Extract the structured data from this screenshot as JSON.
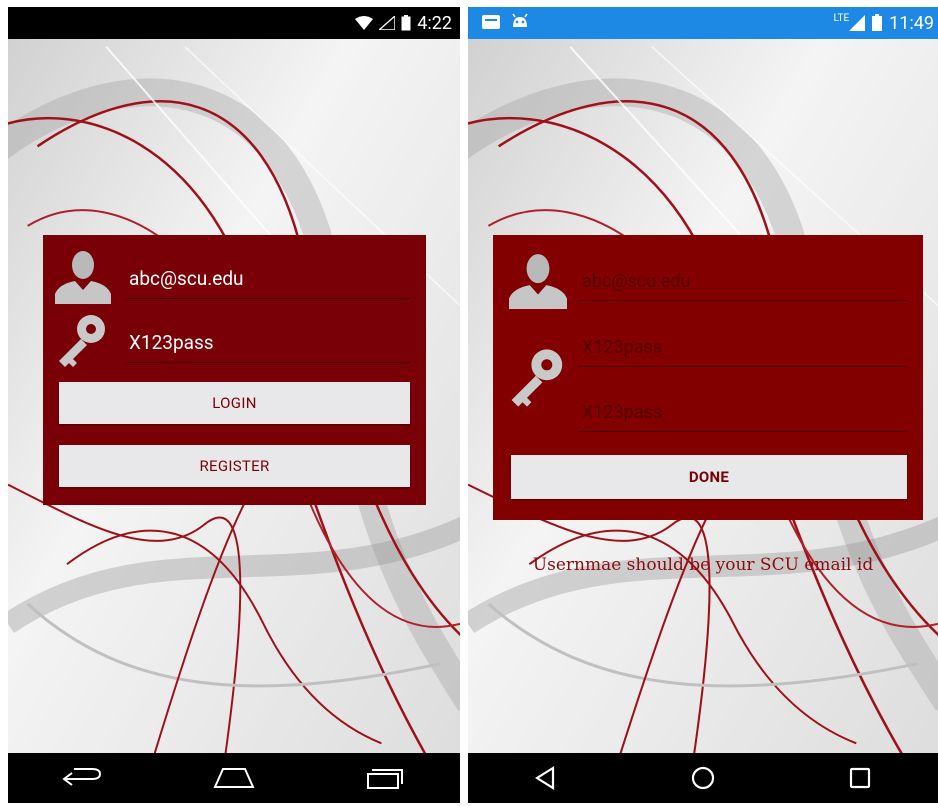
{
  "left": {
    "status": {
      "time": "4:22",
      "icons": [
        "wifi-icon",
        "signal-icon",
        "battery-icon"
      ]
    },
    "login": {
      "username_value": "abc@scu.edu",
      "password_value": "X123pass",
      "login_label": "LOGIN",
      "register_label": "REGISTER"
    },
    "nav": [
      "back-icon",
      "home-icon",
      "recents-icon"
    ]
  },
  "right": {
    "status": {
      "time": "11:49",
      "network": "LTE",
      "icons": [
        "message-icon",
        "android-icon",
        "signal-icon",
        "battery-icon"
      ]
    },
    "register": {
      "username_placeholder": "abc@scu.edu",
      "password_placeholder": "X123pass",
      "confirm_placeholder": "X123pass",
      "done_label": "DONE",
      "hint": "Usernmae should be your SCU email id"
    },
    "nav": [
      "back-triangle-icon",
      "home-circle-icon",
      "recents-square-icon"
    ]
  },
  "colors": {
    "card": "#7a0008",
    "button": "#e8e8ea",
    "button_text": "#7a0008",
    "statusbar_right": "#1e88e5"
  }
}
